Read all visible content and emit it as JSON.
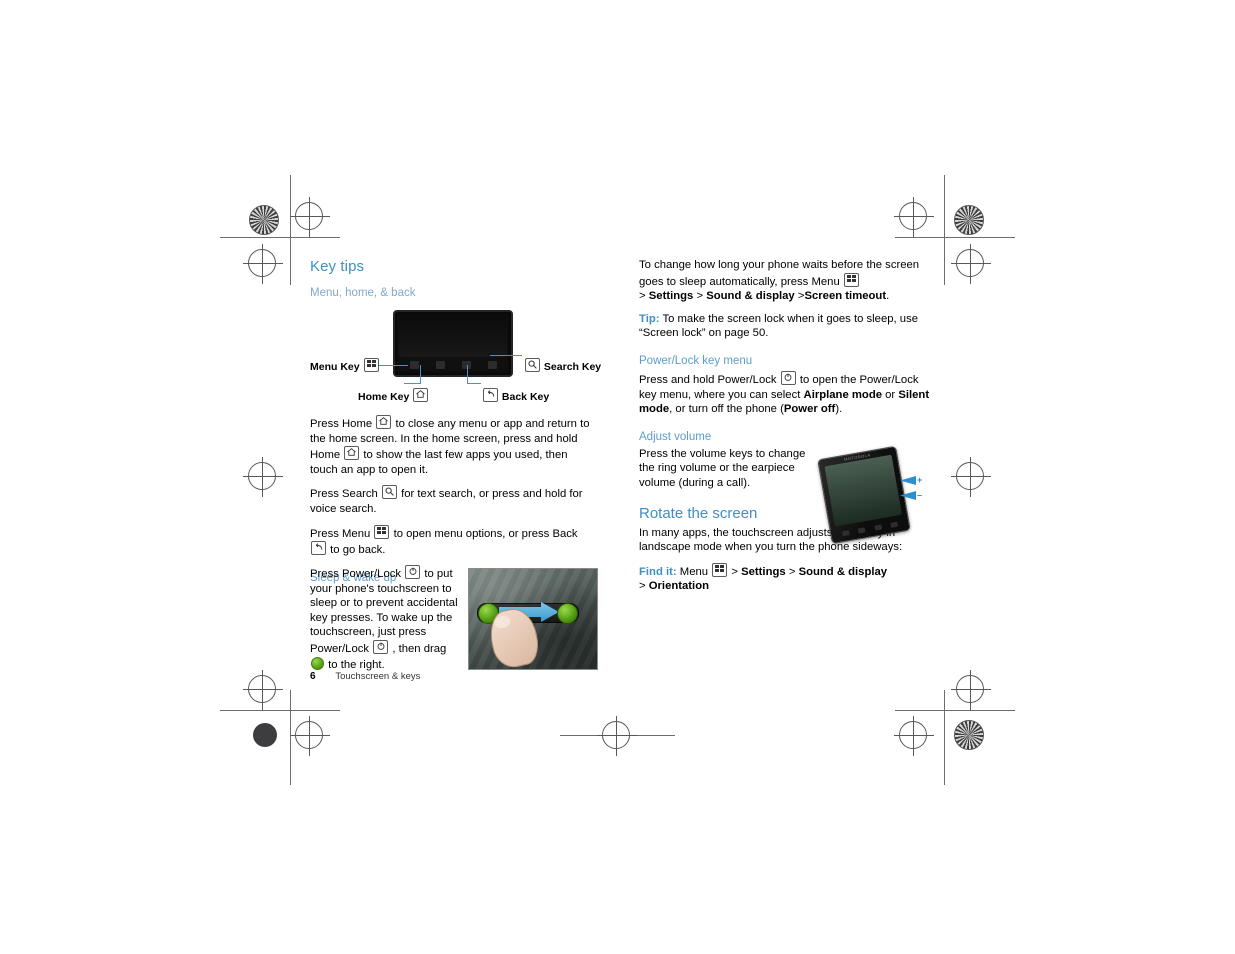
{
  "document": {
    "page_number": "6",
    "footer_caption": "Touchscreen & keys"
  },
  "left_column": {
    "title": "Key tips",
    "subtitle": "Menu, home, & back",
    "figure_labels": {
      "menu_key": "Menu Key",
      "home_key": "Home Key",
      "back_key": "Back Key",
      "search_key": "Search Key"
    },
    "paragraphs": {
      "home": {
        "p1": "Press Home",
        "p2": "to close any menu or app and return to the home screen. In the home screen, press and hold Home",
        "p3": "to show the last few apps you used, then touch an app to open it."
      },
      "search": {
        "p1": "Press Search",
        "p2": "for text search, or press and hold for voice search."
      },
      "menu": {
        "p1": "Press Menu",
        "p2": "to open menu options, or press Back",
        "p3": "to go back."
      }
    },
    "sleep_section": {
      "heading": "Sleep & wake up",
      "p1": "Press Power/Lock",
      "p2": "to put your phone's touchscreen to sleep or to prevent accidental key presses. To wake up the touchscreen, just press Power/Lock",
      "p3": ", then drag",
      "p4": "to the right."
    }
  },
  "right_column": {
    "timeout": {
      "p1": "To change how long your phone waits before the screen goes to sleep automatically, press Menu",
      "p2": ">",
      "settings": "Settings",
      "gt1": ">",
      "sound_display": "Sound & display",
      "gt2": ">",
      "screen_timeout": "Screen timeout",
      "period": "."
    },
    "tip": {
      "label": "Tip:",
      "text": "To make the screen lock when it goes to sleep, use “Screen lock” on page 50."
    },
    "power_lock": {
      "heading": "Power/Lock key menu",
      "p1": "Press and hold Power/Lock",
      "p2": "to open the Power/Lock key menu, where you can select",
      "airplane_mode": "Airplane mode",
      "or1": "or",
      "silent_mode": "Silent mode",
      "p3": ", or turn off the phone (",
      "power_off": "Power off",
      "p4": ")."
    },
    "adjust_volume": {
      "heading": "Adjust volume",
      "text": "Press the volume keys to change the ring volume or the earpiece volume (during a call)."
    },
    "rotate": {
      "heading": "Rotate the screen",
      "text": "In many apps, the touchscreen adjusts to display in landscape mode when you turn the phone sideways:",
      "find_it_label": "Find it:",
      "find_it_menu": "Menu",
      "gt1": ">",
      "settings": "Settings",
      "gt2": ">",
      "sound_display": "Sound & display",
      "gt3": ">",
      "orientation": "Orientation"
    },
    "volume_icons": {
      "plus": "+",
      "minus": "–"
    }
  },
  "colors": {
    "heading_blue": "#3f8fc4",
    "subheading_blue": "#7fa9c6",
    "section_blue": "#5c9dc8",
    "leader_line": "#4a90c4",
    "accent_green": "#6fbe1f"
  }
}
